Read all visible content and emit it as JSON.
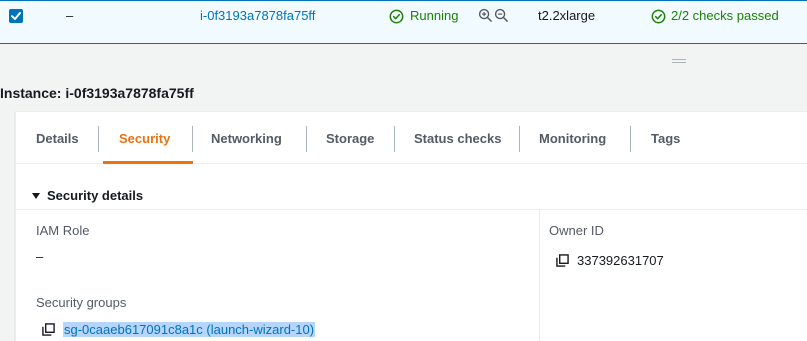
{
  "instance_row": {
    "dash": "–",
    "instance_id": "i-0f3193a7878fa75ff",
    "state": "Running",
    "instance_type": "t2.2xlarge",
    "status_checks": "2/2 checks passed"
  },
  "instance_title": "Instance: i-0f3193a7878fa75ff",
  "tabs": [
    {
      "label": "Details"
    },
    {
      "label": "Security"
    },
    {
      "label": "Networking"
    },
    {
      "label": "Storage"
    },
    {
      "label": "Status checks"
    },
    {
      "label": "Monitoring"
    },
    {
      "label": "Tags"
    }
  ],
  "active_tab": "Security",
  "security": {
    "section_title": "Security details",
    "iam_role_label": "IAM Role",
    "iam_role_value": "–",
    "owner_id_label": "Owner ID",
    "owner_id_value": "337392631707",
    "security_groups_label": "Security groups",
    "security_group_link": "sg-0caaeb617091c8a1c (launch-wizard-10)"
  },
  "colors": {
    "accent": "#0073bb",
    "active_tab": "#ec7211",
    "success": "#1d8102",
    "selection": "#b5d5fb"
  },
  "icons": {
    "checkbox": "checkbox-checked-icon",
    "running": "check-circle-icon",
    "zoom_in": "zoom-in-icon",
    "zoom_out": "zoom-out-icon",
    "copy": "copy-icon",
    "caret": "caret-down-icon"
  }
}
